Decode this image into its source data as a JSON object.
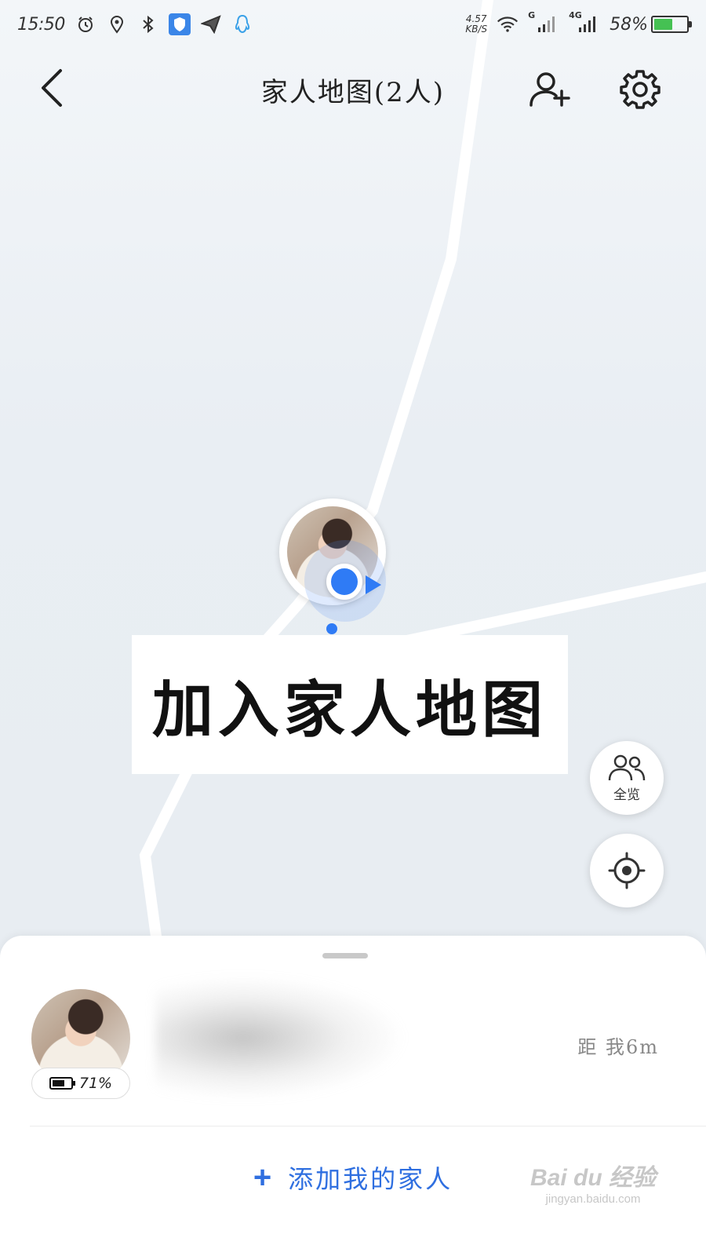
{
  "status_bar": {
    "time": "15:50",
    "net_speed_value": "4.57",
    "net_speed_unit": "KB/S",
    "signal1_label": "G",
    "signal2_label": "4G",
    "battery_percent": "58%",
    "battery_level": 0.58,
    "icons": [
      "alarm-icon",
      "location-icon",
      "bluetooth-icon",
      "shield-icon",
      "send-icon",
      "qq-icon",
      "wifi-icon",
      "signal-icon"
    ]
  },
  "header": {
    "title": "家人地图(2人)",
    "icons": [
      "back-icon",
      "add-person-icon",
      "gear-icon"
    ]
  },
  "caption": {
    "text": "加入家人地图"
  },
  "fab": {
    "overview_label": "全览",
    "icons": [
      "group-icon",
      "locate-icon"
    ]
  },
  "member": {
    "battery": "71%",
    "battery_level": 0.71,
    "distance": "距 我6m"
  },
  "actions": {
    "add_family_plus": "+",
    "add_family_label": "添加我的家人"
  },
  "watermark": {
    "main": "Bai du 经验",
    "sub": "jingyan.baidu.com"
  },
  "colors": {
    "accent": "#2f7bf5",
    "link": "#2f6fe0",
    "battery_green": "#45c153",
    "map_bg": "#e9eef3"
  }
}
